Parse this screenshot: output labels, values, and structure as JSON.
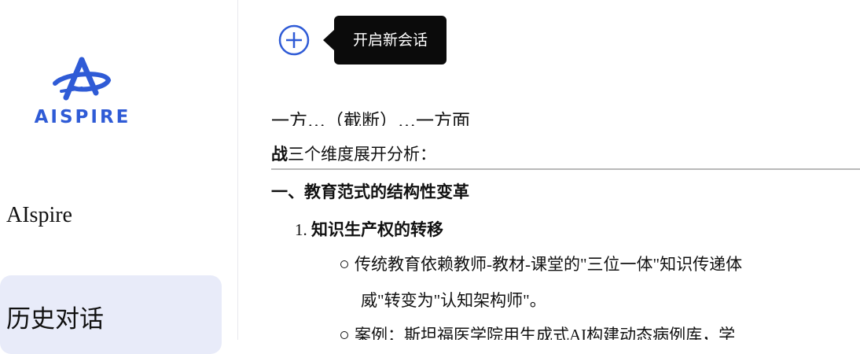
{
  "sidebar": {
    "logo_text": "AISPIRE",
    "app_name": "AIspire",
    "history_label": "历史对话"
  },
  "toolbar": {
    "new_chat_tooltip": "开启新会话"
  },
  "content": {
    "cut_line": "一方…（截断）…一方面",
    "intro_bold": "战",
    "intro_rest": "三个维度展开分析：",
    "section1_heading": "一、教育范式的结构性变革",
    "item1_num": "1.",
    "item1_title": "知识生产权的转移",
    "bullet1": "传统教育依赖教师-教材-课堂的\"三位一体\"知识传递体",
    "bullet1_cont": "威\"转变为\"认知架构师\"。",
    "bullet2": "案例：斯坦福医学院用生成式AI构建动态病例库，学"
  },
  "colors": {
    "brand": "#2f5bd6",
    "history_bg": "#e8ebf9",
    "tooltip_bg": "#0b0b0b"
  }
}
